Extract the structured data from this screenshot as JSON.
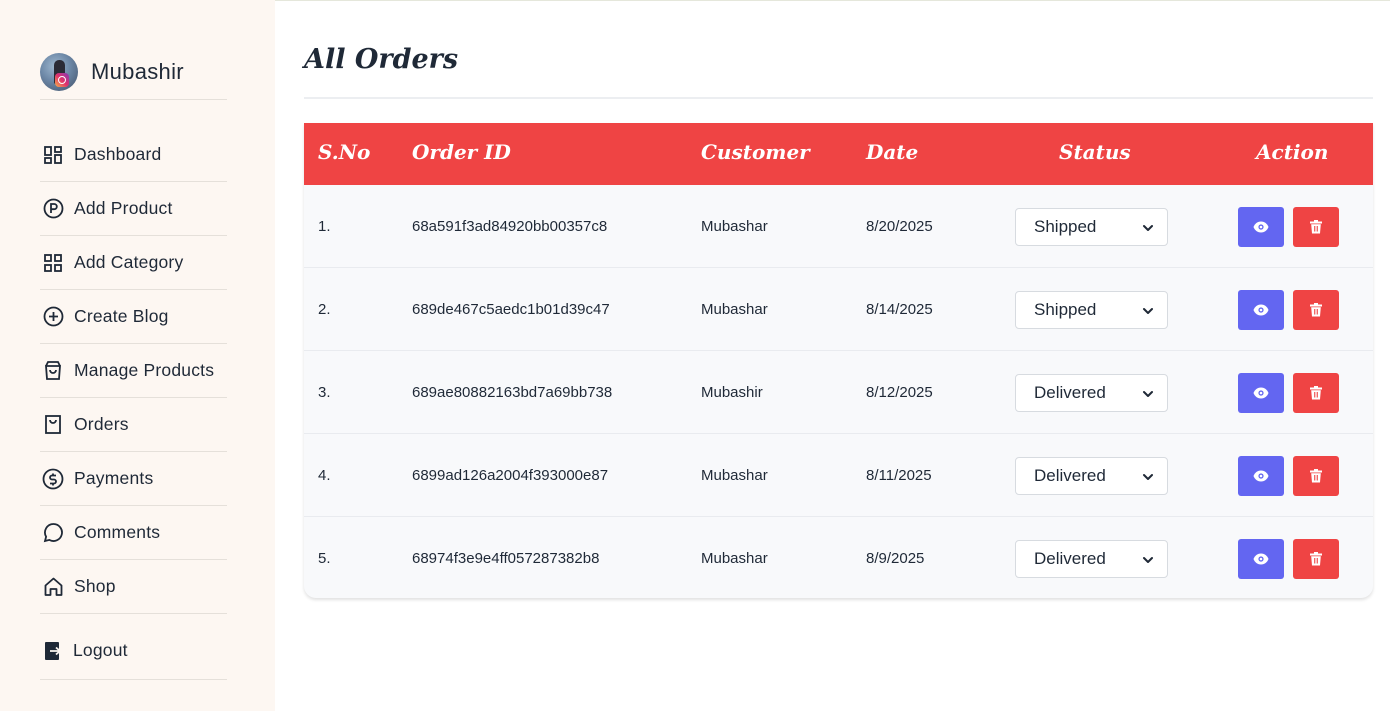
{
  "sidebar": {
    "user_name": "Mubashir",
    "items": [
      {
        "label": "Dashboard",
        "icon": "dashboard-icon"
      },
      {
        "label": "Add Product",
        "icon": "product-p-icon"
      },
      {
        "label": "Add Category",
        "icon": "category-grid-icon"
      },
      {
        "label": "Create Blog",
        "icon": "plus-circle-icon"
      },
      {
        "label": "Manage Products",
        "icon": "shopping-bag-icon"
      },
      {
        "label": "Orders",
        "icon": "orders-bag-icon"
      },
      {
        "label": "Payments",
        "icon": "dollar-circle-icon"
      },
      {
        "label": "Comments",
        "icon": "comment-bubble-icon"
      },
      {
        "label": "Shop",
        "icon": "home-icon"
      }
    ],
    "logout_label": "Logout"
  },
  "main": {
    "title": "All Orders",
    "columns": [
      "S.No",
      "Order ID",
      "Customer",
      "Date",
      "Status",
      "Action"
    ],
    "rows": [
      {
        "sno": "1.",
        "order_id": "68a591f3ad84920bb00357c8",
        "customer": "Mubashar",
        "date": "8/20/2025",
        "status": "Shipped"
      },
      {
        "sno": "2.",
        "order_id": "689de467c5aedc1b01d39c47",
        "customer": "Mubashar",
        "date": "8/14/2025",
        "status": "Shipped"
      },
      {
        "sno": "3.",
        "order_id": "689ae80882163bd7a69bb738",
        "customer": "Mubashir",
        "date": "8/12/2025",
        "status": "Delivered"
      },
      {
        "sno": "4.",
        "order_id": "6899ad126a2004f393000e87",
        "customer": "Mubashar",
        "date": "8/11/2025",
        "status": "Delivered"
      },
      {
        "sno": "5.",
        "order_id": "68974f3e9e4ff057287382b8",
        "customer": "Mubashar",
        "date": "8/9/2025",
        "status": "Delivered"
      }
    ]
  },
  "colors": {
    "header_bg": "#ef4444",
    "view_button": "#6366f1",
    "delete_button": "#ef4444",
    "sidebar_bg": "#fdf7f2"
  }
}
